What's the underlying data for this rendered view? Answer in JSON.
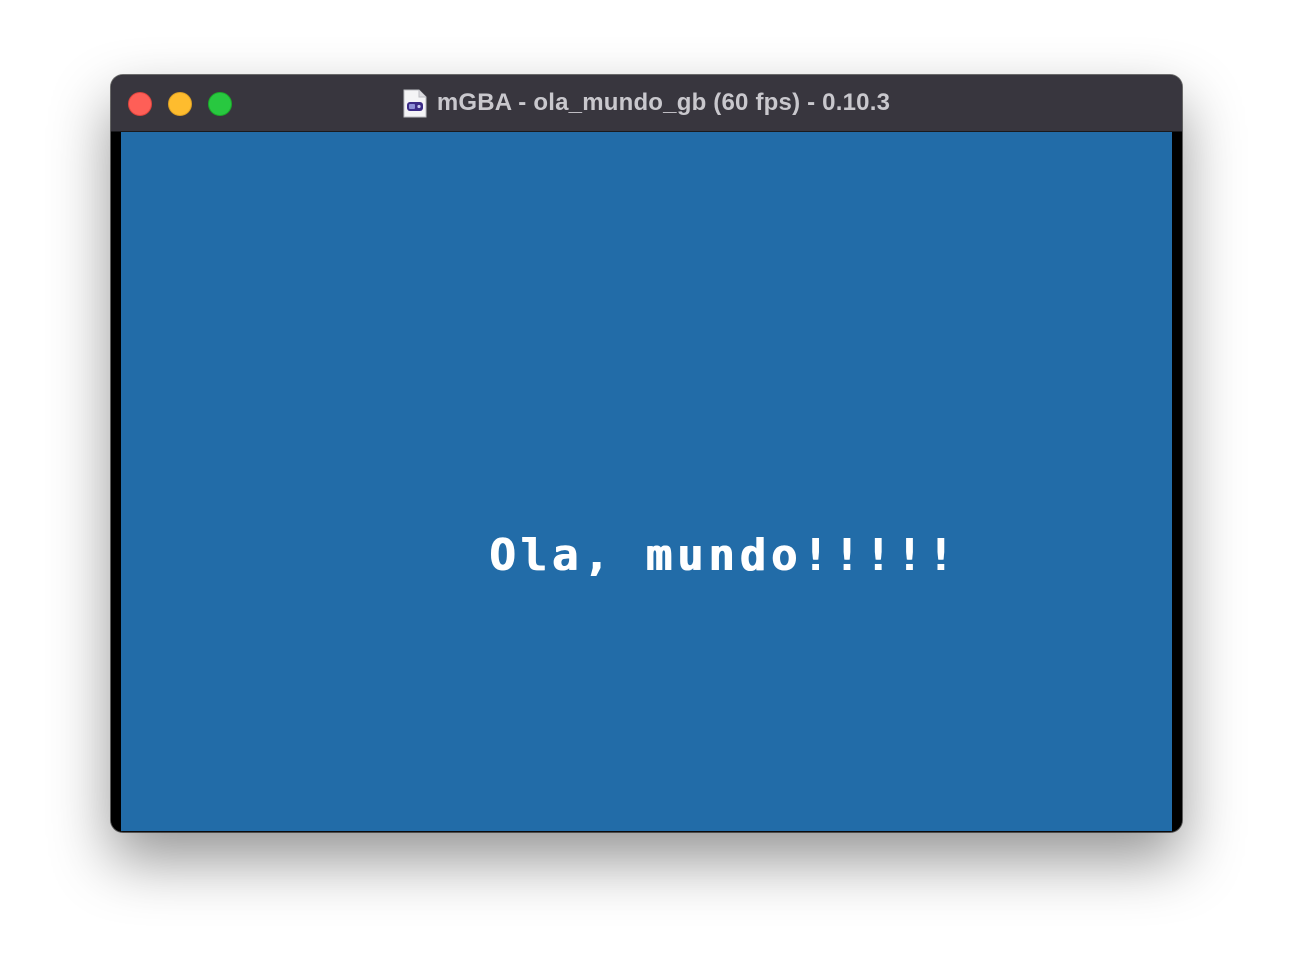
{
  "window": {
    "title": "mGBA - ola_mundo_gb (60 fps) - 0.10.3",
    "document_icon": "rom-file-icon"
  },
  "traffic_lights": {
    "close": "#fe5f57",
    "minimize": "#febc2e",
    "zoom": "#28c840"
  },
  "game_screen": {
    "background_color": "#226ca8",
    "text": "Ola, mundo!!!!!",
    "text_color": "#ffffff"
  }
}
